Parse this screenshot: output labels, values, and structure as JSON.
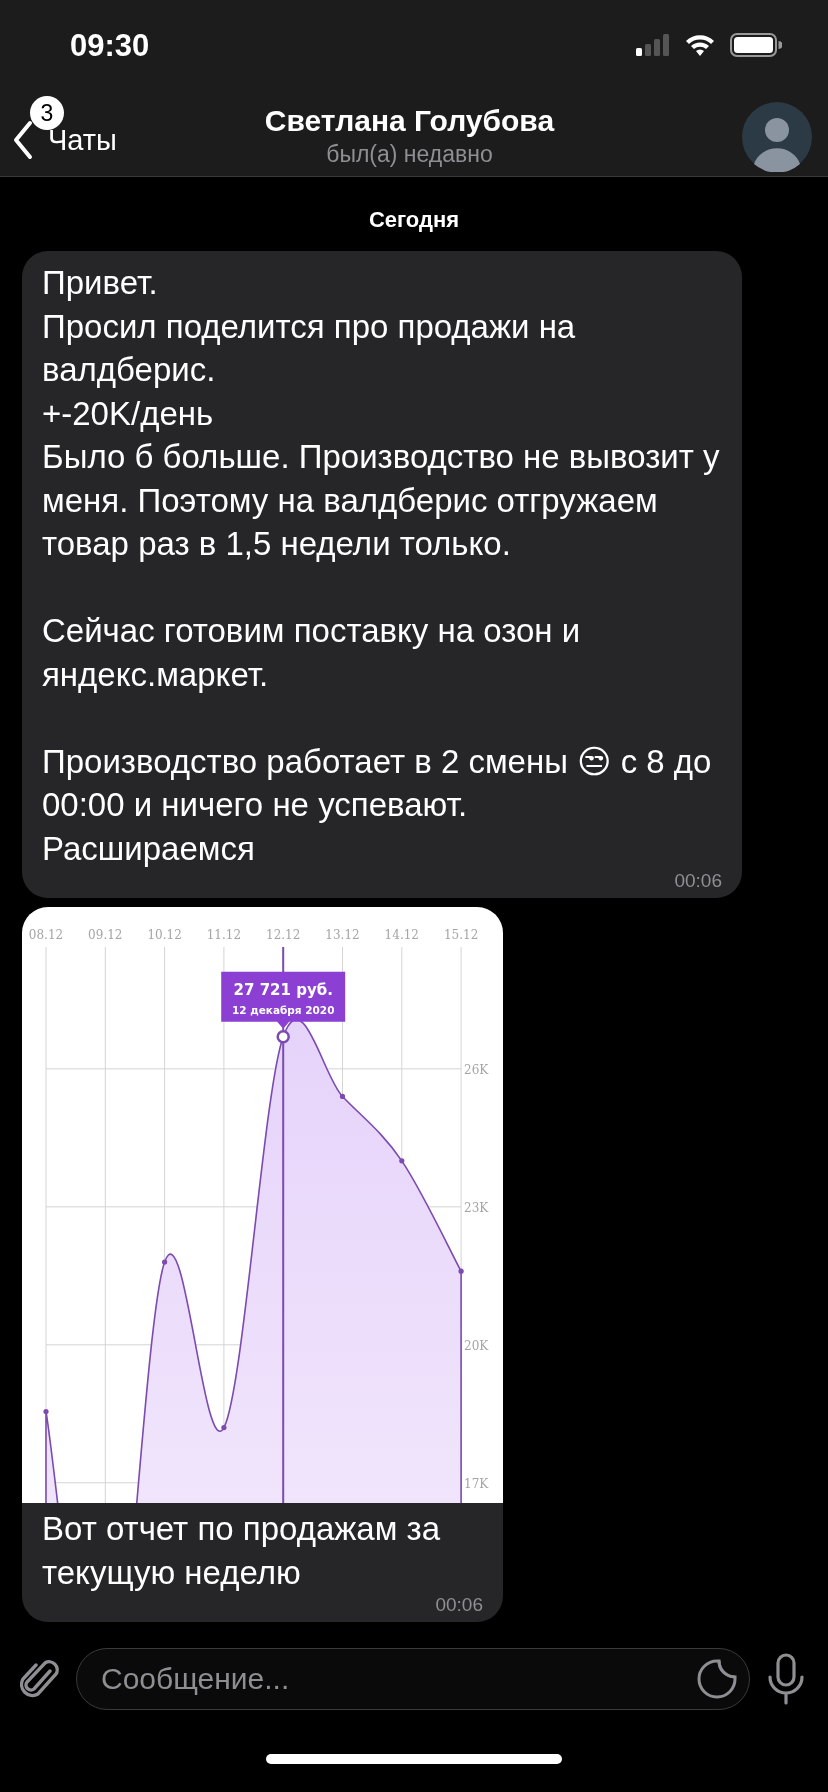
{
  "status_bar": {
    "time": "09:30"
  },
  "header": {
    "back_label": "Чаты",
    "unread_badge": "3",
    "title": "Светлана Голубова",
    "subtitle": "был(а) недавно"
  },
  "date_separator": "Сегодня",
  "messages": [
    {
      "kind": "text",
      "text": "Привет.\nПросил поделится про продажи на валдберис.\n+-20K/день\nБыло б больше. Производство не вывозит у меня. Поэтому на валдберис отгружаем товар раз в 1,5 недели только.\n\nСейчас готовим поставку на озон и яндекс.маркет.\n\nПроизводство работает в 2 смены 😒 с 8 до 00:00 и ничего не успевают.\nРасшираемся",
      "time": "00:06"
    },
    {
      "kind": "chart",
      "caption": "Вот отчет по продажам за текущую неделю",
      "time": "00:06",
      "chart_data": {
        "type": "area",
        "categories": [
          "08.12",
          "09.12",
          "10.12",
          "11.12",
          "12.12",
          "13.12",
          "14.12",
          "15.12"
        ],
        "series": [
          {
            "color": "#7b4bb0",
            "values": [
              18550,
              null,
              21800,
              18200,
              26700,
              25400,
              24000,
              21600
            ]
          }
        ],
        "ylim": [
          16560,
          28650
        ],
        "yticks": [
          {
            "value": 17000,
            "label": "17K"
          },
          {
            "value": 20000,
            "label": "20K"
          },
          {
            "value": 23000,
            "label": "23K"
          },
          {
            "value": 26000,
            "label": "26K"
          }
        ],
        "grid": true,
        "ref_lines": [
          {
            "axis": "x",
            "value": "12.12",
            "color": "#7b4bb0"
          }
        ],
        "annotations": [
          {
            "x": "12.12",
            "y": 26700,
            "text": "27 721 руб."
          },
          {
            "x": "12.12",
            "y": 26700,
            "text": "12 декабря 2020"
          }
        ]
      }
    }
  ],
  "composer": {
    "placeholder": "Сообщение..."
  }
}
